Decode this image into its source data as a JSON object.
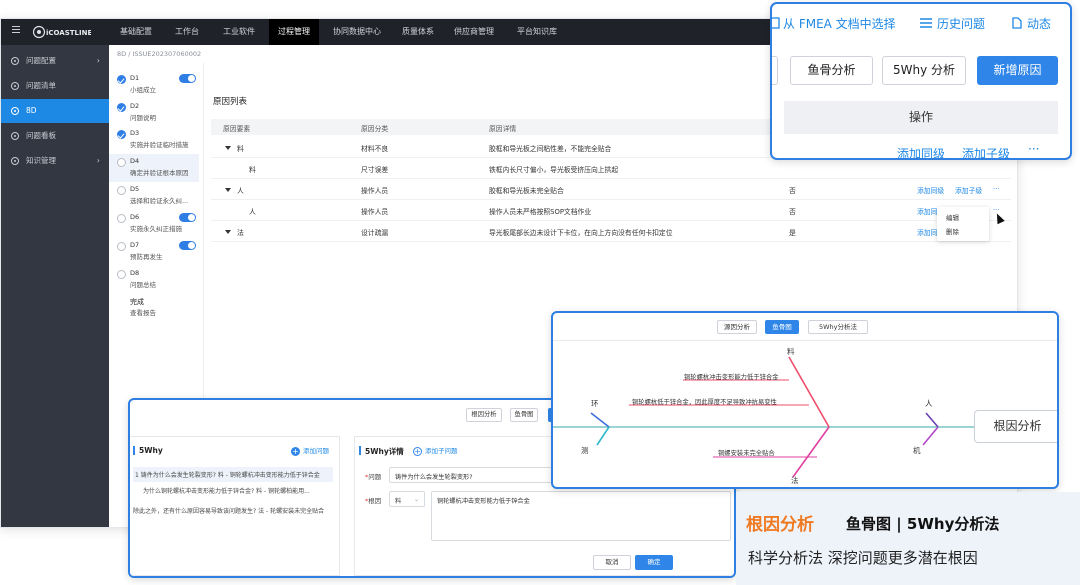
{
  "topbar": {
    "brand": "iCOASTLINE",
    "nav": [
      "基础配置",
      "工作台",
      "工业软件",
      "过程管理",
      "协同数据中心",
      "质量体系",
      "供应商管理",
      "平台知识库"
    ],
    "active_nav": "过程管理"
  },
  "sidebar": {
    "items": [
      {
        "label": "问题配置",
        "chevron": "›"
      },
      {
        "label": "问题清单",
        "chevron": ""
      },
      {
        "label": "8D",
        "chevron": ""
      },
      {
        "label": "问题看板",
        "chevron": ""
      },
      {
        "label": "知识管理",
        "chevron": "›"
      }
    ]
  },
  "breadcrumb": "8D  /  ISSUE202307060002",
  "steps": [
    {
      "code": "D1",
      "name": "小组成立"
    },
    {
      "code": "D2",
      "name": "问题说明"
    },
    {
      "code": "D3",
      "name": "实施并验证临时措施"
    },
    {
      "code": "D4",
      "name": "确定并验证根本原因"
    },
    {
      "code": "D5",
      "name": "选择和验证永久纠..."
    },
    {
      "code": "D6",
      "name": "实施永久纠正措施"
    },
    {
      "code": "D7",
      "name": "预防再发生"
    },
    {
      "code": "D8",
      "name": "问题总结"
    },
    {
      "code": "完成",
      "name": "查看报告"
    }
  ],
  "main": {
    "title": "原因列表",
    "columns": [
      "原因要素",
      "原因分类",
      "原因详情"
    ],
    "rows": [
      {
        "element": "料",
        "category": "材料不良",
        "detail": "胶框和导光板之间粘性差，不能完全贴合",
        "flag": "",
        "a1": "",
        "a2": ""
      },
      {
        "element": "料",
        "category": "尺寸误差",
        "detail": "铁框内长尺寸偏小，导光板受挤压向上拱起",
        "flag": "",
        "a1": "",
        "a2": ""
      },
      {
        "element": "人",
        "category": "操作人员",
        "detail": "胶框和导光板未完全贴合",
        "flag": "否",
        "a1": "添加同级",
        "a2": "添加子级"
      },
      {
        "element": "人",
        "category": "操作人员",
        "detail": "操作人员未严格按照SOP文档作业",
        "flag": "否",
        "a1": "添加同级",
        "a2": ""
      },
      {
        "element": "法",
        "category": "设计疏漏",
        "detail": "导光板尾部长边未设计下卡位，在向上方向没有任何卡扣定位",
        "flag": "是",
        "a1": "添加同级",
        "a2": ""
      }
    ],
    "more": "···",
    "context_menu": [
      "编辑",
      "删除"
    ]
  },
  "actions_card": {
    "links": [
      "从 FMEA 文档中选择",
      "历史问题",
      "动态"
    ],
    "buttons": [
      "鱼骨分析",
      "5Why 分析",
      "新增原因"
    ],
    "ops_header": "操作",
    "row_links": [
      "添加同级",
      "添加子级"
    ],
    "more": "···"
  },
  "fishbone": {
    "tabs": [
      "源因分析",
      "鱼骨图",
      "5Why分析法"
    ],
    "head": "根因分析",
    "categories": [
      "料",
      "环",
      "人",
      "测",
      "法",
      "机"
    ],
    "causes": [
      "铜轮螺杭冲击变形能力低于锌合金",
      "铜轮螺杭低于锌合金，因此厚度不足导致冲抗易变性",
      "铜螺安装未完全贴合"
    ]
  },
  "why_card": {
    "tabs": [
      "根因分析",
      "鱼骨图"
    ],
    "left_title": "5Why",
    "add_question": "添加问题",
    "items": [
      "1 铸件为什么会发生轮裂变形? 料 - 铜轮螺杭冲击变形能力低于锌合金",
      "为什么铜轮螺杭冲击变形能力低于锌合金? 料 - 铜轮螺柏能用...",
      "除此之外，还有什么原因容易导致该问题发生? 法 - 轮螺安装未完全贴合"
    ],
    "right_title": "5Why详情",
    "add_child": "添加子问题",
    "question_label": "问题",
    "question_value": "铸件为什么会发生轮裂变形?",
    "cause_label": "根因",
    "cause_select": "料",
    "cause_value": "铜轮螺杭冲击变形能力低于锌合金",
    "cancel": "取消",
    "confirm": "确定"
  },
  "captions": {
    "line1_highlight": "根因分析",
    "line1_rest": "鱼骨图 | 5Why分析法",
    "line2": "科学分析法  深挖问题更多潜在根因"
  },
  "colors": {
    "primary": "#2f86e8",
    "topbar": "#1f2329",
    "sidebar": "#323741",
    "highlight": "#f07a22"
  }
}
